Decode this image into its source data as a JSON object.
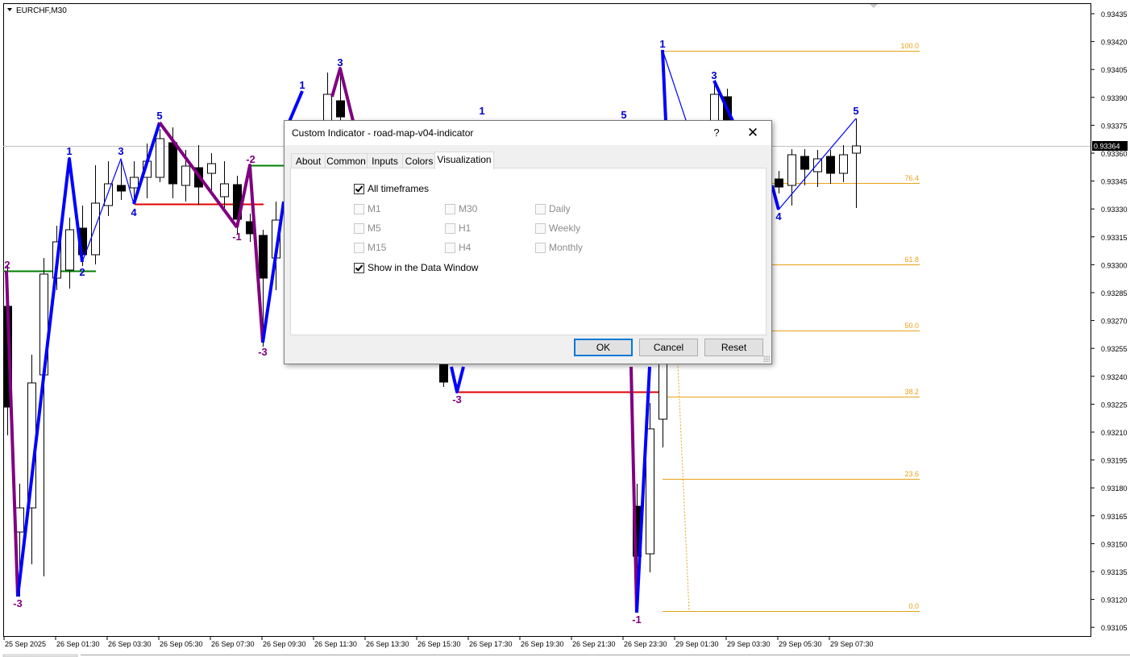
{
  "chart": {
    "symbol_label": "EURCHF,M30",
    "current_price": "0.93364",
    "price_ticks": [
      "0.93435",
      "0.93420",
      "0.93405",
      "0.93390",
      "0.93375",
      "0.93360",
      "0.93345",
      "0.93330",
      "0.93315",
      "0.93300",
      "0.93285",
      "0.93270",
      "0.93255",
      "0.93240",
      "0.93225",
      "0.93210",
      "0.93195",
      "0.93180",
      "0.93165",
      "0.93150",
      "0.93135",
      "0.93120",
      "0.93105"
    ],
    "time_ticks": [
      "25 Sep 2025",
      "26 Sep 01:30",
      "26 Sep 03:30",
      "26 Sep 05:30",
      "26 Sep 07:30",
      "26 Sep 09:30",
      "26 Sep 11:30",
      "26 Sep 13:30",
      "26 Sep 15:30",
      "26 Sep 17:30",
      "26 Sep 19:30",
      "26 Sep 21:30",
      "26 Sep 23:30",
      "29 Sep 01:30",
      "29 Sep 03:30",
      "29 Sep 05:30",
      "29 Sep 07:30"
    ],
    "fib_levels": [
      "100.0",
      "76.4",
      "61.8",
      "50.0",
      "38.2",
      "23.6",
      "0.0"
    ],
    "wave_labels": [
      "2",
      "-3",
      "1",
      "2",
      "3",
      "4",
      "5",
      "-1",
      "-2",
      "-3",
      "1",
      "3",
      "1",
      "-3",
      "5",
      "1",
      "-1",
      "3",
      "4",
      "5"
    ],
    "colors": {
      "up_wave": "#0000ff",
      "down_wave": "#800080",
      "fib": "#e6a117",
      "support": "#008000",
      "resistance": "#e00000",
      "label_blue": "#0000cc",
      "label_purple": "#800080"
    }
  },
  "dialog": {
    "title": "Custom Indicator - road-map-v04-indicator",
    "help_label": "?",
    "close_label": "✕",
    "tabs": [
      "About",
      "Common",
      "Inputs",
      "Colors",
      "Visualization"
    ],
    "active_tab": "Visualization",
    "all_timeframes": {
      "label": "All timeframes",
      "checked": true
    },
    "timeframes": [
      {
        "label": "M1",
        "checked": false
      },
      {
        "label": "M30",
        "checked": false
      },
      {
        "label": "Daily",
        "checked": false
      },
      {
        "label": "M5",
        "checked": false
      },
      {
        "label": "H1",
        "checked": false
      },
      {
        "label": "Weekly",
        "checked": false
      },
      {
        "label": "M15",
        "checked": false
      },
      {
        "label": "H4",
        "checked": false
      },
      {
        "label": "Monthly",
        "checked": false
      }
    ],
    "data_window": {
      "label": "Show in the Data Window",
      "checked": true
    },
    "buttons": {
      "ok": "OK",
      "cancel": "Cancel",
      "reset": "Reset"
    }
  }
}
